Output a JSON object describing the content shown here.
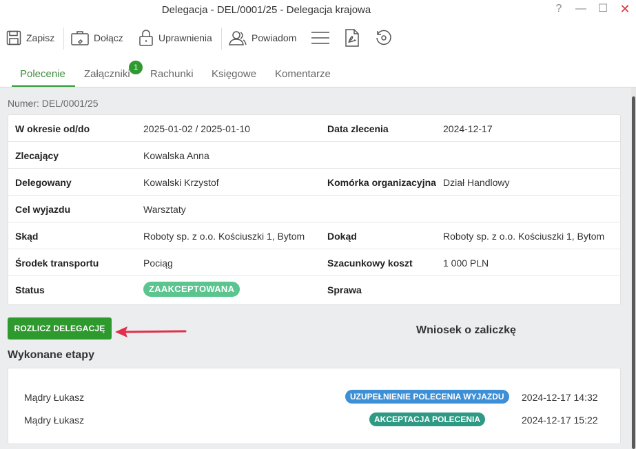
{
  "window": {
    "title": "Delegacja - DEL/0001/25 - Delegacja krajowa",
    "help": "?",
    "minimize": "—",
    "maximize": "☐",
    "close": "✕"
  },
  "toolbar": {
    "save_label": "Zapisz",
    "attach_label": "Dołącz",
    "permissions_label": "Uprawnienia",
    "notify_label": "Powiadom"
  },
  "tabs": [
    {
      "label": "Polecenie",
      "active": true
    },
    {
      "label": "Załączniki",
      "badge": "1"
    },
    {
      "label": "Rachunki"
    },
    {
      "label": "Księgowe"
    },
    {
      "label": "Komentarze"
    }
  ],
  "numer": "Numer: DEL/0001/25",
  "details": {
    "rows": [
      {
        "label1": "W okresie od/do",
        "value1": "2025-01-02 / 2025-01-10",
        "label2": "Data zlecenia",
        "value2": "2024-12-17"
      },
      {
        "label1": "Zlecający",
        "value1": "Kowalska Anna",
        "label2": "",
        "value2": ""
      },
      {
        "label1": "Delegowany",
        "value1": "Kowalski Krzystof",
        "label2": "Komórka organizacyjna",
        "value2": "Dział Handlowy"
      },
      {
        "label1": "Cel wyjazdu",
        "value1": "Warsztaty",
        "label2": "",
        "value2": ""
      },
      {
        "label1": "Skąd",
        "value1": "Roboty sp. z o.o. Kościuszki 1, Bytom",
        "label2": "Dokąd",
        "value2": "Roboty sp. z o.o. Kościuszki 1, Bytom"
      },
      {
        "label1": "Środek transportu",
        "value1": "Pociąg",
        "label2": "Szacunkowy koszt",
        "value2": "1 000 PLN"
      },
      {
        "label1": "Status",
        "value1": "ZAAKCEPTOWANA",
        "label2": "Sprawa",
        "value2": ""
      }
    ]
  },
  "actions": {
    "settle_label": "ROZLICZ DELEGACJĘ",
    "advance_label": "Wniosek o zaliczkę"
  },
  "stages": {
    "title": "Wykonane etapy",
    "items": [
      {
        "person": "Mądry Łukasz",
        "step": "UZUPEŁNIENIE POLECENIA WYJAZDU",
        "date": "2024-12-17 14:32",
        "color": "#3d8fd6"
      },
      {
        "person": "Mądry Łukasz",
        "step": "AKCEPTACJA POLECENIA",
        "date": "2024-12-17 15:22",
        "color": "#2e9a84"
      }
    ]
  },
  "colors": {
    "accent": "#2e9a2e",
    "status_accepted": "#5cc48e",
    "arrow": "#e0304a"
  }
}
